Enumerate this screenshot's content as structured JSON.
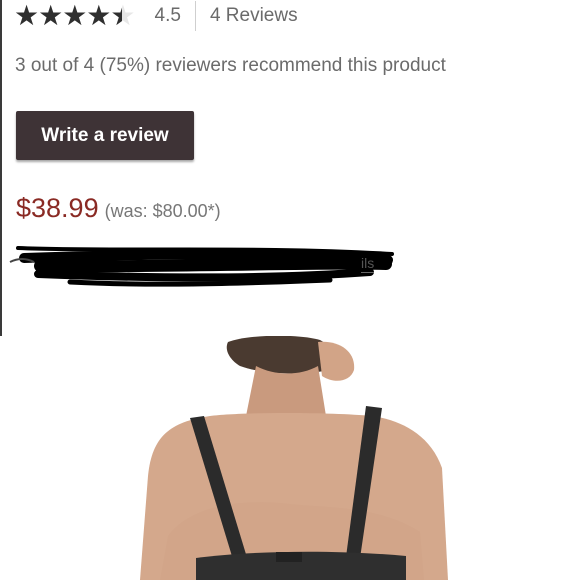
{
  "rating": {
    "value": "4.5",
    "score": 4.5,
    "max": 5,
    "reviews_label": "4 Reviews"
  },
  "recommend_text": "3 out of 4 (75%) reviewers recommend this product",
  "write_review_label": "Write a review",
  "price": {
    "current": "$38.99",
    "was": "(was: $80.00*)"
  },
  "details_link_fragment": "ils",
  "colors": {
    "button_bg": "#3e3336",
    "price_red": "#8a2a24",
    "star_fill": "#2f2f2f"
  },
  "icons": {
    "star": "star-icon",
    "redaction": "redaction-scribble"
  }
}
